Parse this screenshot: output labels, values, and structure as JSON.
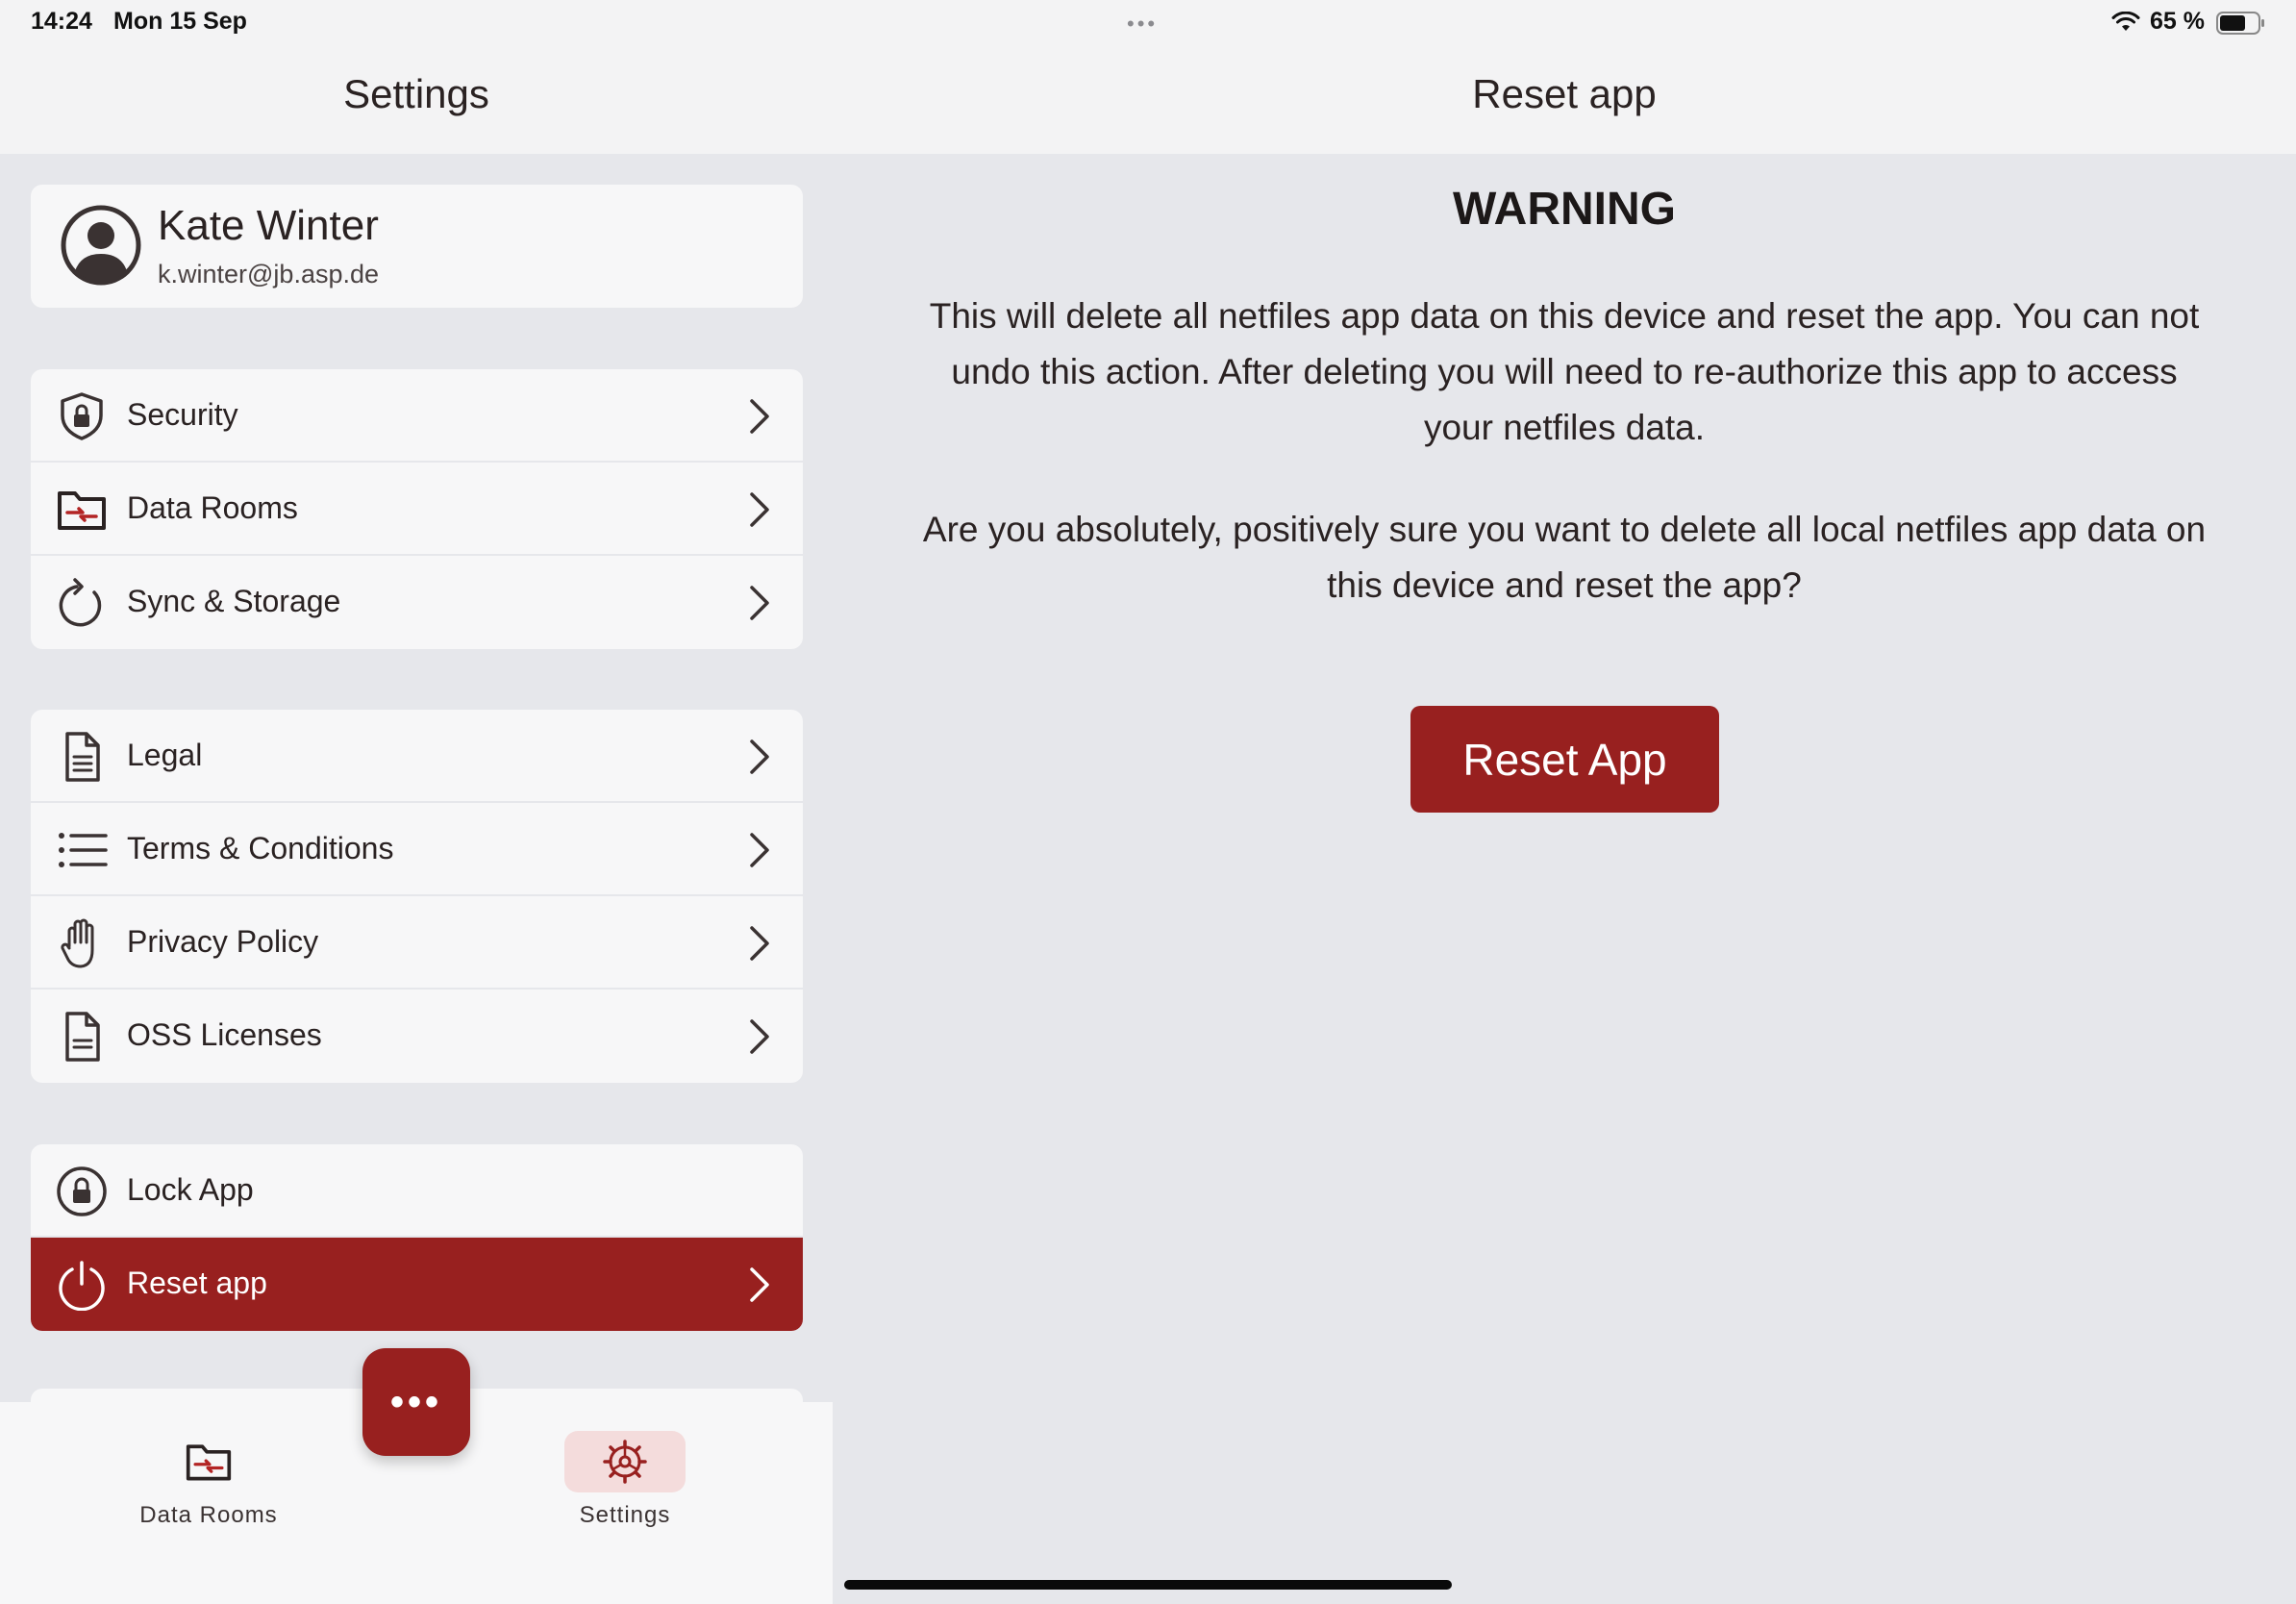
{
  "status_bar": {
    "time": "14:24",
    "date": "Mon 15 Sep",
    "multitask": "•••",
    "battery": "65 %",
    "icons": [
      "wifi-icon",
      "battery-icon"
    ]
  },
  "sidebar": {
    "title": "Settings",
    "profile": {
      "name": "Kate Winter",
      "email": "k.winter@jb.asp.de",
      "icon": "avatar-icon"
    },
    "groups": [
      [
        {
          "label": "Security",
          "icon": "shield-lock-icon"
        },
        {
          "label": "Data Rooms",
          "icon": "data-room-folder-icon"
        },
        {
          "label": "Sync & Storage",
          "icon": "sync-icon"
        }
      ],
      [
        {
          "label": "Legal",
          "icon": "document-icon"
        },
        {
          "label": "Terms & Conditions",
          "icon": "list-icon"
        },
        {
          "label": "Privacy Policy",
          "icon": "hand-icon"
        },
        {
          "label": "OSS Licenses",
          "icon": "document-icon"
        }
      ],
      [
        {
          "label": "Lock App",
          "icon": "lock-icon"
        },
        {
          "label": "Reset app",
          "icon": "power-icon",
          "active": true
        }
      ]
    ]
  },
  "tabbar": {
    "tabs": [
      {
        "label": "Data Rooms",
        "icon": "data-room-folder-icon"
      },
      {
        "label": "Settings",
        "icon": "gear-icon",
        "selected": true
      }
    ],
    "fab": "•••"
  },
  "detail": {
    "title": "Reset app",
    "warning_title": "WARNING",
    "paragraph1": "This will delete all netfiles app data on this device and reset the app. You can not undo this action. After deleting you will need to re-authorize this app to access your netfiles data.",
    "paragraph2": "Are you absolutely, positively sure you want to delete all local netfiles app data on this device and reset the app?",
    "button": "Reset App"
  },
  "colors": {
    "accent": "#98201f",
    "background": "#e6e7eb",
    "card": "#f7f7f8",
    "text": "#2a2222"
  }
}
